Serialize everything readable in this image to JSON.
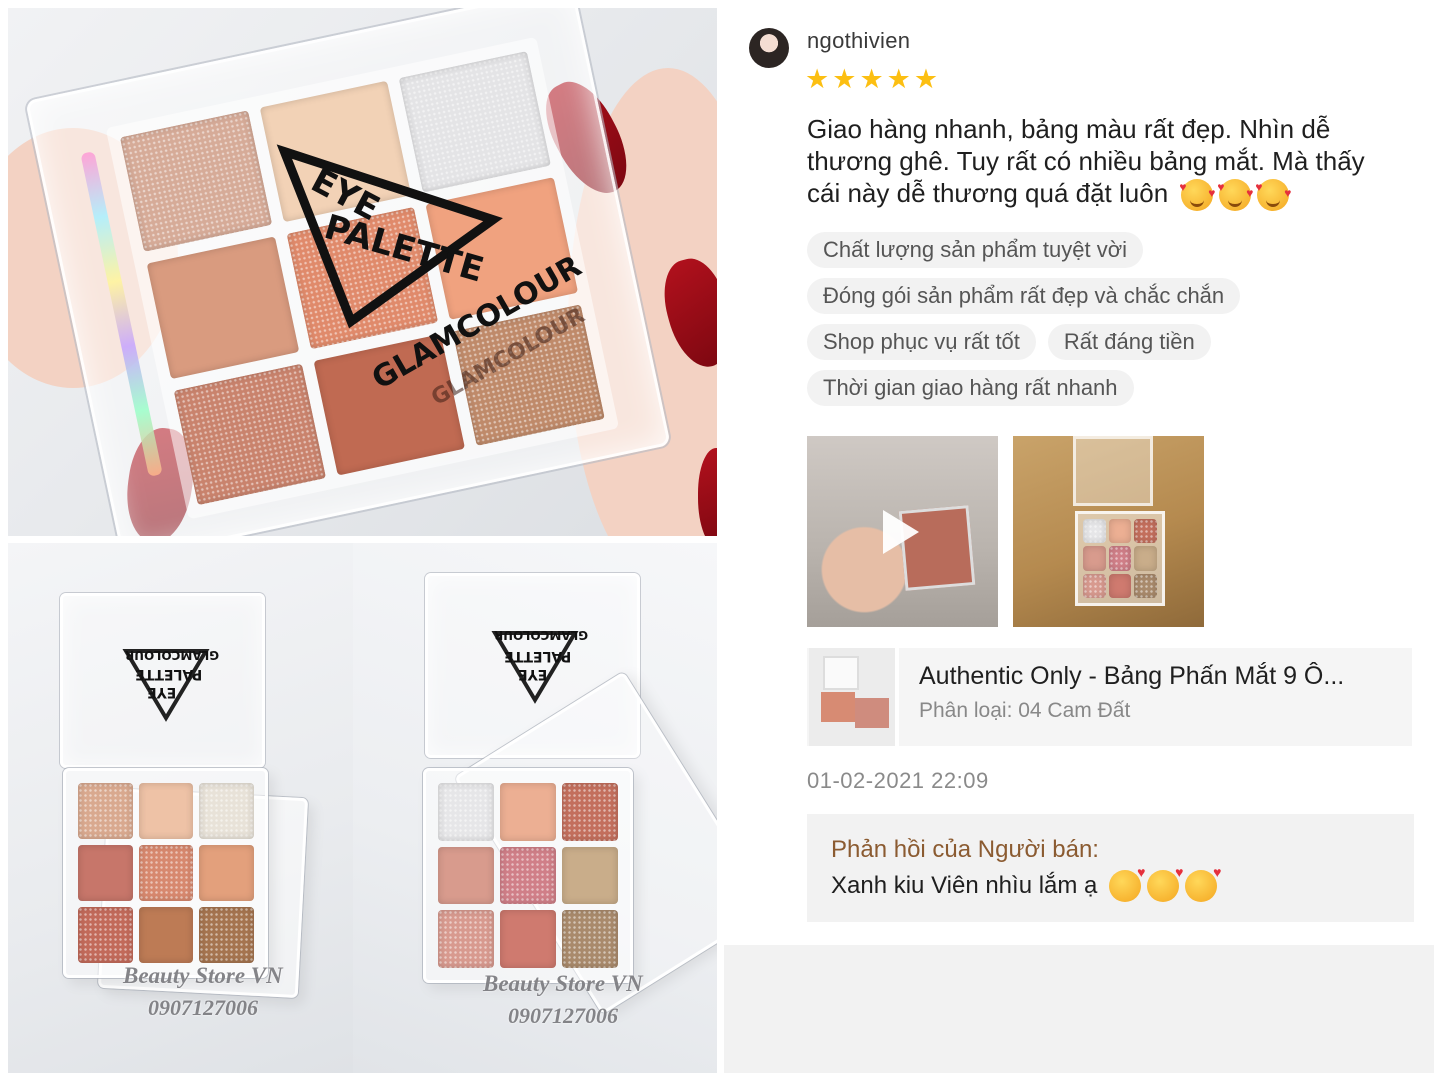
{
  "collage": {
    "top_logo": {
      "line1": "EYE",
      "line2": "PALETTE",
      "brand": "GLAMCOLOUR",
      "pan_brand": "GLAMCOLOUR"
    },
    "bottom_left": {
      "lid_text_1": "EYE",
      "lid_text_2": "PALETTE",
      "lid_text_3": "GLAMCOLOUR",
      "watermark_name": "Beauty Store VN",
      "watermark_phone": "0907127006",
      "pans": [
        "#d9a98f",
        "#eec2a6",
        "#e8e2d8",
        "#c7766a",
        "#d7886e",
        "#e3a07c",
        "#c26a5a",
        "#bd7b55",
        "#a5744f"
      ]
    },
    "bottom_right": {
      "lid_text_1": "EYE",
      "lid_text_2": "PALETTE",
      "lid_text_3": "GLAMCOLOUR",
      "watermark_name": "Beauty Store VN",
      "watermark_phone": "0907127006",
      "pans": [
        "#e6e6e8",
        "#ecaf93",
        "#c36f5d",
        "#d89b8d",
        "#d07f88",
        "#c9ad8a",
        "#d89a8f",
        "#cf7a6f",
        "#a98a6c"
      ]
    },
    "top_pans": [
      "#d6ab98",
      "#f2d2b6",
      "#e4e4e6",
      "#d99b7f",
      "#e08a6b",
      "#f0a27f",
      "#c9836d",
      "#c06a52",
      "#bf8a6a",
      "#c46c5a",
      "#b97a52",
      "#a86c49"
    ]
  },
  "review": {
    "username": "ngothivien",
    "rating": 5,
    "star_glyph": "★",
    "text_line1": "Giao hàng nhanh, bảng màu rất đẹp. Nhìn dễ",
    "text_line2": "thương ghê. Tuy rất có nhiều bảng mắt. Mà thấy",
    "text_line3": "cái này dễ thương quá đặt luôn",
    "emoji_name": "smiling-face-with-hearts",
    "tags": [
      "Chất lượng sản phẩm tuyệt vời",
      "Đóng gói sản phẩm rất đẹp và chắc chắn",
      "Shop phục vụ rất tốt",
      "Rất đáng tiền",
      "Thời gian giao hàng rất nhanh"
    ],
    "media": [
      {
        "type": "video",
        "icon": "play-icon"
      },
      {
        "type": "image"
      }
    ],
    "product": {
      "name": "Authentic Only - Bảng Phấn Mắt 9 Ô...",
      "variant": "Phân loại: 04 Cam Đất"
    },
    "timestamp": "01-02-2021 22:09",
    "seller_reply": {
      "title": "Phản hồi của Người bán:",
      "message": "Xanh kiu Viên nhìu lắm ạ",
      "emoji_name": "face-blowing-a-kiss"
    }
  },
  "colors": {
    "star": "#fcbf12",
    "seller_title": "#8b5b31",
    "tag_bg": "#f2f2f2",
    "nail": "#b3111d"
  }
}
